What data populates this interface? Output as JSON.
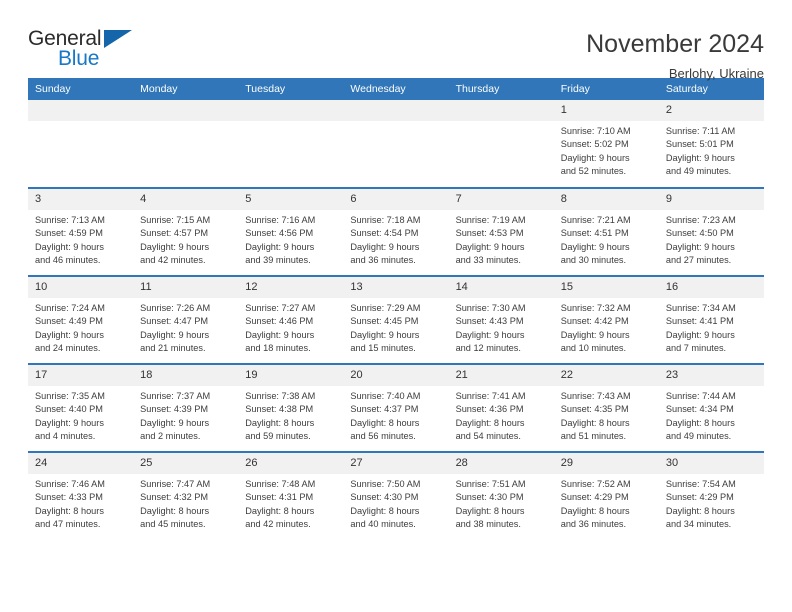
{
  "brand": {
    "name_part1": "General",
    "name_part2": "Blue",
    "triangle_color": "#1565ab",
    "blue_color": "#1878c8"
  },
  "header": {
    "title": "November 2024",
    "location": "Berlohy, Ukraine"
  },
  "theme": {
    "header_blue": "#3076b8",
    "daynum_bg": "#f1f1f1"
  },
  "weekdays": [
    "Sunday",
    "Monday",
    "Tuesday",
    "Wednesday",
    "Thursday",
    "Friday",
    "Saturday"
  ],
  "weeks": [
    [
      {
        "day": "",
        "sunrise": "",
        "sunset": "",
        "daylight1": "",
        "daylight2": ""
      },
      {
        "day": "",
        "sunrise": "",
        "sunset": "",
        "daylight1": "",
        "daylight2": ""
      },
      {
        "day": "",
        "sunrise": "",
        "sunset": "",
        "daylight1": "",
        "daylight2": ""
      },
      {
        "day": "",
        "sunrise": "",
        "sunset": "",
        "daylight1": "",
        "daylight2": ""
      },
      {
        "day": "",
        "sunrise": "",
        "sunset": "",
        "daylight1": "",
        "daylight2": ""
      },
      {
        "day": "1",
        "sunrise": "Sunrise: 7:10 AM",
        "sunset": "Sunset: 5:02 PM",
        "daylight1": "Daylight: 9 hours",
        "daylight2": "and 52 minutes."
      },
      {
        "day": "2",
        "sunrise": "Sunrise: 7:11 AM",
        "sunset": "Sunset: 5:01 PM",
        "daylight1": "Daylight: 9 hours",
        "daylight2": "and 49 minutes."
      }
    ],
    [
      {
        "day": "3",
        "sunrise": "Sunrise: 7:13 AM",
        "sunset": "Sunset: 4:59 PM",
        "daylight1": "Daylight: 9 hours",
        "daylight2": "and 46 minutes."
      },
      {
        "day": "4",
        "sunrise": "Sunrise: 7:15 AM",
        "sunset": "Sunset: 4:57 PM",
        "daylight1": "Daylight: 9 hours",
        "daylight2": "and 42 minutes."
      },
      {
        "day": "5",
        "sunrise": "Sunrise: 7:16 AM",
        "sunset": "Sunset: 4:56 PM",
        "daylight1": "Daylight: 9 hours",
        "daylight2": "and 39 minutes."
      },
      {
        "day": "6",
        "sunrise": "Sunrise: 7:18 AM",
        "sunset": "Sunset: 4:54 PM",
        "daylight1": "Daylight: 9 hours",
        "daylight2": "and 36 minutes."
      },
      {
        "day": "7",
        "sunrise": "Sunrise: 7:19 AM",
        "sunset": "Sunset: 4:53 PM",
        "daylight1": "Daylight: 9 hours",
        "daylight2": "and 33 minutes."
      },
      {
        "day": "8",
        "sunrise": "Sunrise: 7:21 AM",
        "sunset": "Sunset: 4:51 PM",
        "daylight1": "Daylight: 9 hours",
        "daylight2": "and 30 minutes."
      },
      {
        "day": "9",
        "sunrise": "Sunrise: 7:23 AM",
        "sunset": "Sunset: 4:50 PM",
        "daylight1": "Daylight: 9 hours",
        "daylight2": "and 27 minutes."
      }
    ],
    [
      {
        "day": "10",
        "sunrise": "Sunrise: 7:24 AM",
        "sunset": "Sunset: 4:49 PM",
        "daylight1": "Daylight: 9 hours",
        "daylight2": "and 24 minutes."
      },
      {
        "day": "11",
        "sunrise": "Sunrise: 7:26 AM",
        "sunset": "Sunset: 4:47 PM",
        "daylight1": "Daylight: 9 hours",
        "daylight2": "and 21 minutes."
      },
      {
        "day": "12",
        "sunrise": "Sunrise: 7:27 AM",
        "sunset": "Sunset: 4:46 PM",
        "daylight1": "Daylight: 9 hours",
        "daylight2": "and 18 minutes."
      },
      {
        "day": "13",
        "sunrise": "Sunrise: 7:29 AM",
        "sunset": "Sunset: 4:45 PM",
        "daylight1": "Daylight: 9 hours",
        "daylight2": "and 15 minutes."
      },
      {
        "day": "14",
        "sunrise": "Sunrise: 7:30 AM",
        "sunset": "Sunset: 4:43 PM",
        "daylight1": "Daylight: 9 hours",
        "daylight2": "and 12 minutes."
      },
      {
        "day": "15",
        "sunrise": "Sunrise: 7:32 AM",
        "sunset": "Sunset: 4:42 PM",
        "daylight1": "Daylight: 9 hours",
        "daylight2": "and 10 minutes."
      },
      {
        "day": "16",
        "sunrise": "Sunrise: 7:34 AM",
        "sunset": "Sunset: 4:41 PM",
        "daylight1": "Daylight: 9 hours",
        "daylight2": "and 7 minutes."
      }
    ],
    [
      {
        "day": "17",
        "sunrise": "Sunrise: 7:35 AM",
        "sunset": "Sunset: 4:40 PM",
        "daylight1": "Daylight: 9 hours",
        "daylight2": "and 4 minutes."
      },
      {
        "day": "18",
        "sunrise": "Sunrise: 7:37 AM",
        "sunset": "Sunset: 4:39 PM",
        "daylight1": "Daylight: 9 hours",
        "daylight2": "and 2 minutes."
      },
      {
        "day": "19",
        "sunrise": "Sunrise: 7:38 AM",
        "sunset": "Sunset: 4:38 PM",
        "daylight1": "Daylight: 8 hours",
        "daylight2": "and 59 minutes."
      },
      {
        "day": "20",
        "sunrise": "Sunrise: 7:40 AM",
        "sunset": "Sunset: 4:37 PM",
        "daylight1": "Daylight: 8 hours",
        "daylight2": "and 56 minutes."
      },
      {
        "day": "21",
        "sunrise": "Sunrise: 7:41 AM",
        "sunset": "Sunset: 4:36 PM",
        "daylight1": "Daylight: 8 hours",
        "daylight2": "and 54 minutes."
      },
      {
        "day": "22",
        "sunrise": "Sunrise: 7:43 AM",
        "sunset": "Sunset: 4:35 PM",
        "daylight1": "Daylight: 8 hours",
        "daylight2": "and 51 minutes."
      },
      {
        "day": "23",
        "sunrise": "Sunrise: 7:44 AM",
        "sunset": "Sunset: 4:34 PM",
        "daylight1": "Daylight: 8 hours",
        "daylight2": "and 49 minutes."
      }
    ],
    [
      {
        "day": "24",
        "sunrise": "Sunrise: 7:46 AM",
        "sunset": "Sunset: 4:33 PM",
        "daylight1": "Daylight: 8 hours",
        "daylight2": "and 47 minutes."
      },
      {
        "day": "25",
        "sunrise": "Sunrise: 7:47 AM",
        "sunset": "Sunset: 4:32 PM",
        "daylight1": "Daylight: 8 hours",
        "daylight2": "and 45 minutes."
      },
      {
        "day": "26",
        "sunrise": "Sunrise: 7:48 AM",
        "sunset": "Sunset: 4:31 PM",
        "daylight1": "Daylight: 8 hours",
        "daylight2": "and 42 minutes."
      },
      {
        "day": "27",
        "sunrise": "Sunrise: 7:50 AM",
        "sunset": "Sunset: 4:30 PM",
        "daylight1": "Daylight: 8 hours",
        "daylight2": "and 40 minutes."
      },
      {
        "day": "28",
        "sunrise": "Sunrise: 7:51 AM",
        "sunset": "Sunset: 4:30 PM",
        "daylight1": "Daylight: 8 hours",
        "daylight2": "and 38 minutes."
      },
      {
        "day": "29",
        "sunrise": "Sunrise: 7:52 AM",
        "sunset": "Sunset: 4:29 PM",
        "daylight1": "Daylight: 8 hours",
        "daylight2": "and 36 minutes."
      },
      {
        "day": "30",
        "sunrise": "Sunrise: 7:54 AM",
        "sunset": "Sunset: 4:29 PM",
        "daylight1": "Daylight: 8 hours",
        "daylight2": "and 34 minutes."
      }
    ]
  ]
}
